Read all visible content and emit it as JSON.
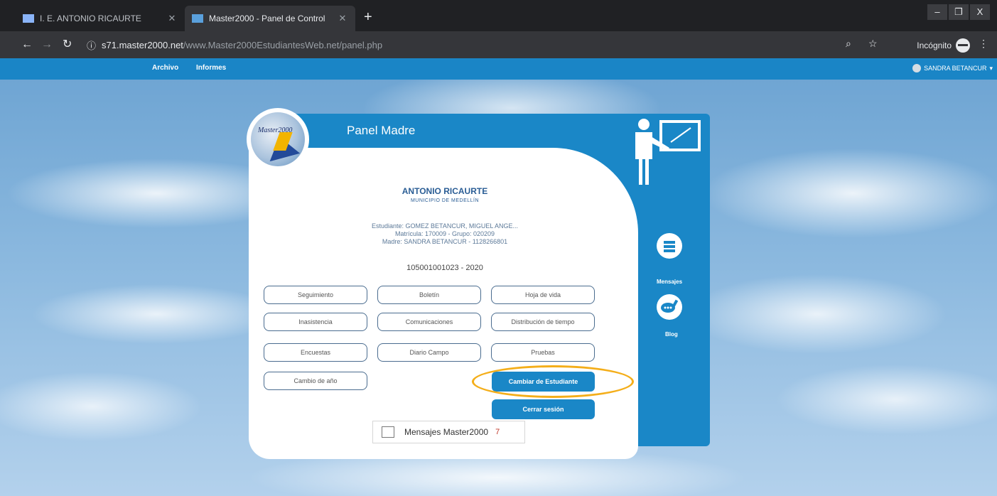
{
  "browser": {
    "tabs": [
      {
        "title": "I. E. ANTONIO RICAURTE",
        "active": false
      },
      {
        "title": "Master2000 - Panel de Control",
        "active": true
      }
    ],
    "url_host": "s71.master2000.net",
    "url_path": "/www.Master2000EstudiantesWeb.net/panel.php",
    "incognito_label": "Incógnito",
    "window_controls": [
      "–",
      "❐",
      "X"
    ]
  },
  "appbar": {
    "menu": [
      "Archivo",
      "Informes"
    ],
    "user": "SANDRA BETANCUR"
  },
  "panel": {
    "title": "Panel Madre",
    "logo_text": "Master2000",
    "school_name": "ANTONIO RICAURTE",
    "school_sub": "MUNICIPIO DE MEDELLÍN",
    "student_line": "Estudiante: GOMEZ BETANCUR, MIGUEL ANGE...",
    "matricula_line": "Matrícula: 170009 - Grupo: 020209",
    "madre_line": "Madre: SANDRA BETANCUR - 1128266801",
    "code": "105001001023 - 2020",
    "buttons": [
      "Seguimiento",
      "Boletín",
      "Hoja de vida",
      "Inasistencia",
      "Comunicaciones",
      "Distribución de tiempo",
      "Encuestas",
      "Diario Campo",
      "Pruebas",
      "Cambio de año"
    ],
    "switch_student": "Cambiar de Estudiante",
    "logout": "Cerrar sesión",
    "side": {
      "mensajes": "Mensajes",
      "blog": "Blog"
    },
    "msg_label": "Mensajes Master2000",
    "msg_count": "7"
  },
  "colors": {
    "brand_blue": "#1a87c7",
    "highlight_oval": "#f4ae1a",
    "chrome_dark": "#202124"
  }
}
